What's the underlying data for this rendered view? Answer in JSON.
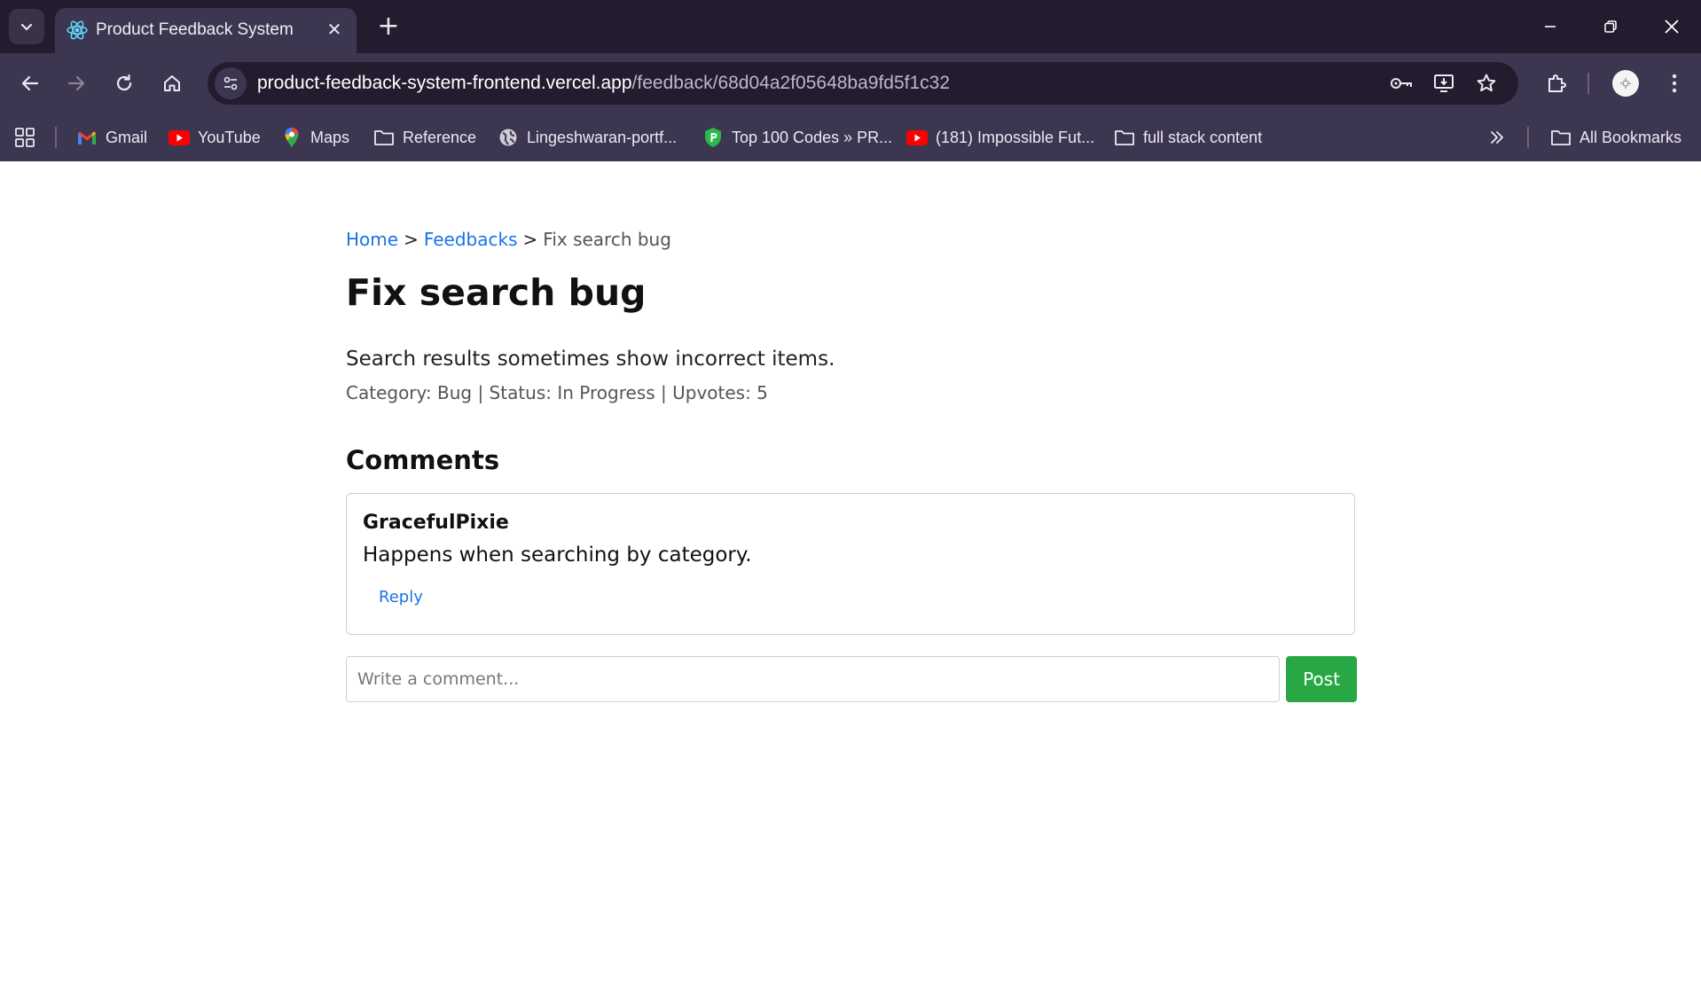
{
  "browser": {
    "tab": {
      "title": "Product Feedback System",
      "favicon": "react-icon"
    },
    "url": {
      "host": "product-feedback-system-frontend.vercel.app",
      "path": "/feedback/68d04a2f05648ba9fd5f1c32"
    },
    "bookmarks": [
      {
        "label": "Gmail",
        "icon": "gmail-icon"
      },
      {
        "label": "YouTube",
        "icon": "youtube-icon"
      },
      {
        "label": "Maps",
        "icon": "maps-icon"
      },
      {
        "label": "Reference",
        "icon": "folder-icon"
      },
      {
        "label": "Lingeshwaran-portf...",
        "icon": "globe-icon"
      },
      {
        "label": "Top 100 Codes » PR...",
        "icon": "shield-icon"
      },
      {
        "label": "(181) Impossible Fut...",
        "icon": "youtube-icon"
      },
      {
        "label": "full stack content",
        "icon": "folder-icon"
      }
    ],
    "all_bookmarks": "All Bookmarks"
  },
  "breadcrumb": {
    "home": "Home",
    "separator": ">",
    "feedbacks": "Feedbacks",
    "current": "Fix search bug"
  },
  "feedback": {
    "title": "Fix search bug",
    "description": "Search results sometimes show incorrect items.",
    "meta": "Category: Bug | Status: In Progress | Upvotes: 5"
  },
  "comments": {
    "heading": "Comments",
    "items": [
      {
        "author": "GracefulPixie",
        "text": "Happens when searching by category.",
        "reply_label": "Reply"
      }
    ],
    "input_placeholder": "Write a comment...",
    "post_label": "Post"
  },
  "colors": {
    "link": "#1a73e8",
    "post_button": "#28a745",
    "chrome_dark": "#221c2e",
    "chrome": "#3d3650"
  }
}
